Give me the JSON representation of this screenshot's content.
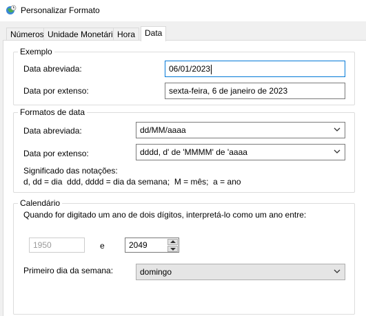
{
  "window": {
    "title": "Personalizar Formato",
    "icon": "globe-clock-icon"
  },
  "tabs": [
    {
      "label": "Números"
    },
    {
      "label": "Unidade Monetária"
    },
    {
      "label": "Hora"
    },
    {
      "label": "Data",
      "active": true
    }
  ],
  "exemplo": {
    "legend": "Exemplo",
    "short_label": "Data abreviada:",
    "short_value": "06/01/2023",
    "long_label": "Data por extenso:",
    "long_value": "sexta-feira, 6 de janeiro de 2023"
  },
  "formatos": {
    "legend": "Formatos de data",
    "short_label": "Data abreviada:",
    "short_value": "dd/MM/aaaa",
    "long_label": "Data por extenso:",
    "long_value": "dddd, d' de 'MMMM' de 'aaaa",
    "notation_title": "Significado das notações:",
    "notation_text": "d, dd = dia  ddd, dddd = dia da semana;  M = mês;  a = ano"
  },
  "calendario": {
    "legend": "Calendário",
    "two_digit_text": "Quando for digitado um ano de dois dígitos, interpretá-lo como um ano entre:",
    "year_from": "1950",
    "conjunction": "e",
    "year_to": "2049",
    "first_day_label": "Primeiro dia da semana:",
    "first_day_value": "domingo"
  },
  "colors": {
    "focus_border": "#0078d7",
    "disabled_text": "#999999"
  }
}
